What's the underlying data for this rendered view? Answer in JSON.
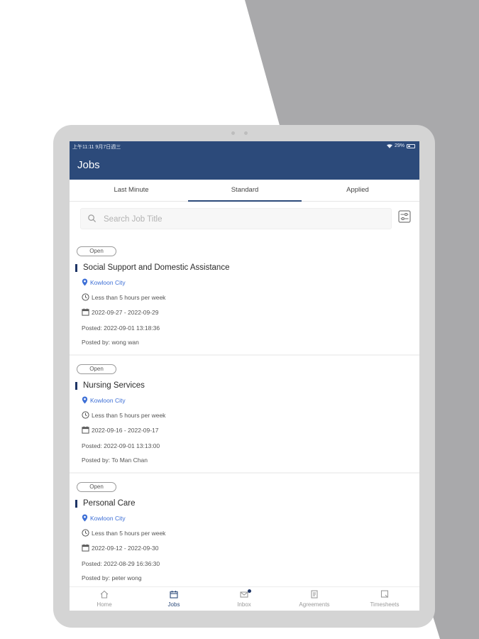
{
  "status_bar": {
    "time": "上午11:11 9月7日週三",
    "battery": "29%"
  },
  "app_bar": {
    "title": "Jobs"
  },
  "tabs": [
    {
      "label": "Last Minute",
      "active": false
    },
    {
      "label": "Standard",
      "active": true
    },
    {
      "label": "Applied",
      "active": false
    }
  ],
  "search": {
    "placeholder": "Search Job Title"
  },
  "jobs": [
    {
      "status": "Open",
      "title": "Social Support and Domestic Assistance",
      "location": "Kowloon City",
      "hours": "Less than 5 hours per week",
      "dates": "2022-09-27 - 2022-09-29",
      "posted": "Posted: 2022-09-01 13:18:36",
      "posted_by": "Posted by: wong wan"
    },
    {
      "status": "Open",
      "title": "Nursing Services",
      "location": "Kowloon City",
      "hours": "Less than 5 hours per week",
      "dates": "2022-09-16 - 2022-09-17",
      "posted": "Posted: 2022-09-01 13:13:00",
      "posted_by": "Posted by: To Man Chan"
    },
    {
      "status": "Open",
      "title": "Personal Care",
      "location": "Kowloon City",
      "hours": "Less than 5 hours per week",
      "dates": "2022-09-12 - 2022-09-30",
      "posted": "Posted: 2022-08-29 16:36:30",
      "posted_by": "Posted by: peter wong"
    }
  ],
  "bottom_nav": [
    {
      "label": "Home",
      "icon": "home-icon",
      "active": false
    },
    {
      "label": "Jobs",
      "icon": "jobs-icon",
      "active": true
    },
    {
      "label": "Inbox",
      "icon": "inbox-icon",
      "active": false
    },
    {
      "label": "Agreements",
      "icon": "agreements-icon",
      "active": false
    },
    {
      "label": "Timesheets",
      "icon": "timesheets-icon",
      "active": false
    }
  ],
  "colors": {
    "primary": "#2c4a7a",
    "location_link": "#3d6fd6",
    "background_gray": "#a9a9ab"
  }
}
